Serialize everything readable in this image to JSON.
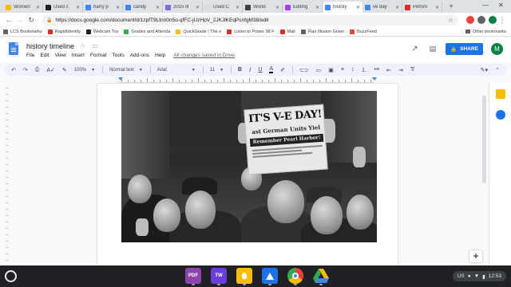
{
  "tabs": [
    {
      "title": "Women'",
      "color": "#fbbc04",
      "active": false
    },
    {
      "title": "Used c",
      "color": "#202124",
      "active": false
    },
    {
      "title": "harry p",
      "color": "#4285f4",
      "active": false
    },
    {
      "title": "candy",
      "color": "#4285f4",
      "active": false
    },
    {
      "title": "2015 Ill",
      "color": "#7b6fd6",
      "active": false
    },
    {
      "title": "Used C",
      "color": "#dadce0",
      "active": false
    },
    {
      "title": "World",
      "color": "#3c4043",
      "active": false
    },
    {
      "title": "Editing",
      "color": "#a142f4",
      "active": false
    },
    {
      "title": "history",
      "color": "#4285f4",
      "active": true
    },
    {
      "title": "ve day",
      "color": "#4285f4",
      "active": false
    },
    {
      "title": "PetSm",
      "color": "#d93025",
      "active": false
    }
  ],
  "newtab_label": "+",
  "window": {
    "minimize": "—",
    "close": "✕"
  },
  "address": {
    "url": "https://docs.google.com/document/d/1zpfT9Ltnn0n5o-qfFC-jUzHpV_2JKJlKEqPcnfgM38/edit"
  },
  "bookmarks": [
    {
      "label": "LCS Bookmarks",
      "color": "#5f6368"
    },
    {
      "label": "RapidIdentity",
      "color": "#d93025"
    },
    {
      "label": "Webcam Toy",
      "color": "#202124"
    },
    {
      "label": "Grades and Attenda",
      "color": "#34a853"
    },
    {
      "label": "QuickGrade | The e",
      "color": "#fbbc04"
    },
    {
      "label": "Listen to Power 98 F",
      "color": "#d93025"
    },
    {
      "label": "Mail",
      "color": "#d93025"
    },
    {
      "label": "Flair Illusion Gown",
      "color": "#5f6368"
    },
    {
      "label": "BuzzFeed",
      "color": "#e8453c"
    }
  ],
  "other_bookmarks": "Other bookmarks",
  "doc": {
    "title": "history timeline",
    "menu": [
      "File",
      "Edit",
      "View",
      "Insert",
      "Format",
      "Tools",
      "Add-ons",
      "Help"
    ],
    "saved_status": "All changes saved in Drive",
    "share_label": "SHARE",
    "avatar_letter": "M"
  },
  "toolbar": {
    "zoom": "100%",
    "style": "Normal text",
    "font": "Arial",
    "size": "11"
  },
  "photo": {
    "headline": "IT'S V-E DAY!",
    "subhead": "ast German Units Yiel",
    "band": "Remember Pearl Harbor!"
  },
  "tray": {
    "locale": "US",
    "time": "12:53"
  },
  "shelf_apps": [
    {
      "name": "pdf-app",
      "label": "PDF",
      "color": "#8e44ad"
    },
    {
      "name": "tw-app",
      "label": "TW",
      "color": "#6a3fd6"
    },
    {
      "name": "keep-app",
      "label": "",
      "color": "#fbbc04"
    },
    {
      "name": "classroom-app",
      "label": "",
      "color": "#1a73e8"
    },
    {
      "name": "chrome-app",
      "label": "",
      "color": "#ffffff"
    },
    {
      "name": "drive-app",
      "label": "",
      "color": "#ffffff"
    }
  ]
}
